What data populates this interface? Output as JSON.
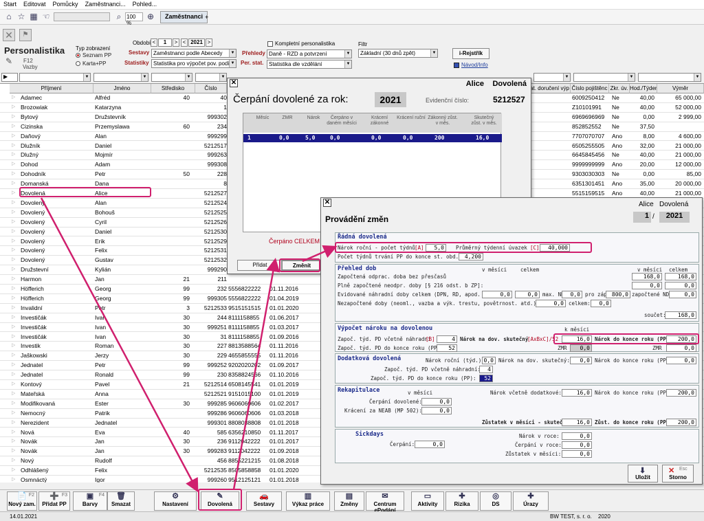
{
  "menu": [
    "Start",
    "Editovat",
    "Pomůcky",
    "Zaměstnanci...",
    "Pohled..."
  ],
  "toolbar": {
    "zoom": "100 %",
    "tab_label": "Zaměstnanci",
    "tab_add": "+"
  },
  "header": {
    "app_title": "Personalistika",
    "f12": "F12",
    "vazby": "Vazby",
    "typ_zobrazeni": "Typ zobrazení",
    "radio_seznam": "Seznam PP",
    "radio_karta": "Karta+PP",
    "obdobi_label": "Období",
    "obdobi_month": "1",
    "obdobi_year": "2021",
    "nav_prev": "<",
    "nav_next": ">",
    "sestavy_label": "Sestavy",
    "sestavy_value": "Zaměstnanci podle Abecedy",
    "statistiky_label": "Statistiky",
    "statistiky_value": "Statistika pro výpočet pov. podílu",
    "kompletni": "Kompletní personalistika",
    "prehledy_label": "Přehledy",
    "prehledy_value": "Daně - RZD a potvrzení",
    "perstat_label": "Per. stat.",
    "perstat_value": "Statistika dle vzdělání",
    "filtr_label": "Filtr",
    "filtr_value": "Základní (30 dnů zpět)",
    "irejstrik": "i-Rejstřík",
    "navod": "Návod/Info"
  },
  "grid": {
    "headers": [
      "Příjmení",
      "Jméno",
      "Středisko",
      "Číslo",
      "at. doručení výp",
      "Číslo pojištěnc",
      "Zkr. úv.",
      "Hod./Týden",
      "Výměr"
    ],
    "rows": [
      {
        "p": "Adamec",
        "j": "Alfréd",
        "s": "40",
        "c": "40",
        "e": "",
        "f": "",
        "pj": "6009250412",
        "z": "Ne",
        "h": "40,00",
        "v": "65 000,00"
      },
      {
        "p": "Brozowiak",
        "j": "Katarzyna",
        "s": "",
        "c": "1",
        "e": "",
        "f": "",
        "pj": "Z10101991",
        "z": "Ne",
        "h": "40,00",
        "v": "52 000,00"
      },
      {
        "p": "Bytový",
        "j": "Družstevník",
        "s": "",
        "c": "999302",
        "e": "",
        "f": "",
        "pj": "6969696969",
        "z": "Ne",
        "h": "0,00",
        "v": "2 999,00"
      },
      {
        "p": "Cizinska",
        "j": "Przemyslawa",
        "s": "60",
        "c": "234",
        "e": "",
        "f": "",
        "pj": "852852552",
        "z": "Ne",
        "h": "37,50",
        "v": ""
      },
      {
        "p": "Daňový",
        "j": "Alan",
        "s": "",
        "c": "999299",
        "e": "",
        "f": "",
        "pj": "7707070707",
        "z": "Ano",
        "h": "8,00",
        "v": "4 600,00"
      },
      {
        "p": "Dlužník",
        "j": "Daniel",
        "s": "",
        "c": "5212517",
        "e": "",
        "f": "",
        "pj": "6505255505",
        "z": "Ano",
        "h": "32,00",
        "v": "21 000,00"
      },
      {
        "p": "Dlužný",
        "j": "Mojmír",
        "s": "",
        "c": "999263",
        "e": "",
        "f": "",
        "pj": "6645845456",
        "z": "Ne",
        "h": "40,00",
        "v": "21 000,00"
      },
      {
        "p": "Dohod",
        "j": "Adam",
        "s": "",
        "c": "999308",
        "e": "",
        "f": "",
        "pj": "9999999999",
        "z": "Ano",
        "h": "20,00",
        "v": "12 000,00"
      },
      {
        "p": "Dohodník",
        "j": "Petr",
        "s": "50",
        "c": "228",
        "e": "",
        "f": "",
        "pj": "9303030303",
        "z": "Ne",
        "h": "0,00",
        "v": "85,00"
      },
      {
        "p": "Domanská",
        "j": "Dana",
        "s": "",
        "c": "8",
        "e": "",
        "f": "",
        "pj": "6351301451",
        "z": "Ano",
        "h": "35,00",
        "v": "20 000,00"
      },
      {
        "p": "Dovolená",
        "j": "Alice",
        "s": "",
        "c": "5212527",
        "e": "",
        "f": "",
        "pj": "5515159515",
        "z": "Ano",
        "h": "40,00",
        "v": "21 000,00"
      },
      {
        "p": "Dovolený",
        "j": "Alan",
        "s": "",
        "c": "5212524",
        "e": "",
        "f": "",
        "pj": "",
        "z": "",
        "h": "",
        "v": ""
      },
      {
        "p": "Dovolený",
        "j": "Bohouš",
        "s": "",
        "c": "5212525",
        "e": "",
        "f": "",
        "pj": "",
        "z": "",
        "h": "",
        "v": ""
      },
      {
        "p": "Dovolený",
        "j": "Cyril",
        "s": "",
        "c": "5212526",
        "e": "",
        "f": "",
        "pj": "",
        "z": "",
        "h": "",
        "v": ""
      },
      {
        "p": "Dovolený",
        "j": "Daniel",
        "s": "",
        "c": "5212530",
        "e": "",
        "f": "",
        "pj": "",
        "z": "",
        "h": "",
        "v": ""
      },
      {
        "p": "Dovolený",
        "j": "Erik",
        "s": "",
        "c": "5212529",
        "e": "",
        "f": "",
        "pj": "",
        "z": "",
        "h": "",
        "v": ""
      },
      {
        "p": "Dovolený",
        "j": "Felix",
        "s": "",
        "c": "5212531",
        "e": "",
        "f": "",
        "pj": "",
        "z": "",
        "h": "",
        "v": ""
      },
      {
        "p": "Dovolený",
        "j": "Gustav",
        "s": "",
        "c": "5212532",
        "e": "",
        "f": "",
        "pj": "",
        "z": "",
        "h": "",
        "v": ""
      },
      {
        "p": "Družstevní",
        "j": "Kylián",
        "s": "",
        "c": "999290",
        "e": "",
        "f": "",
        "pj": "",
        "z": "",
        "h": "",
        "v": ""
      },
      {
        "p": "Harmon",
        "j": "Jan",
        "s": "21",
        "c": "211",
        "e": "",
        "f": "",
        "pj": "",
        "z": "",
        "h": "",
        "v": ""
      },
      {
        "p": "Höfferich",
        "j": "Georg",
        "s": "99",
        "c": "232",
        "e": "5556822222",
        "f": "01.11.2016",
        "pj": "",
        "z": "",
        "h": "",
        "v": ""
      },
      {
        "p": "Höfferich",
        "j": "Georg",
        "s": "99",
        "c": "999305",
        "e": "5556822222",
        "f": "01.04.2019",
        "pj": "",
        "z": "",
        "h": "",
        "v": ""
      },
      {
        "p": "Invalidní",
        "j": "Petr",
        "s": "3",
        "c": "5212533",
        "e": "9515151515",
        "f": "01.01.2020",
        "pj": "",
        "z": "",
        "h": "",
        "v": ""
      },
      {
        "p": "Investičák",
        "j": "Ivan",
        "s": "30",
        "c": "244",
        "e": "8111158855",
        "f": "01.06.2017",
        "pj": "",
        "z": "",
        "h": "",
        "v": ""
      },
      {
        "p": "Investičák",
        "j": "Ivan",
        "s": "30",
        "c": "999251",
        "e": "8111158855",
        "f": "01.03.2017",
        "pj": "",
        "z": "",
        "h": "",
        "v": ""
      },
      {
        "p": "Investičák",
        "j": "Ivan",
        "s": "30",
        "c": "31",
        "e": "8111158855",
        "f": "01.09.2016",
        "pj": "",
        "z": "",
        "h": "",
        "v": ""
      },
      {
        "p": "Investik",
        "j": "Roman",
        "s": "30",
        "c": "227",
        "e": "8813588564",
        "f": "01.11.2016",
        "pj": "",
        "z": "",
        "h": "",
        "v": ""
      },
      {
        "p": "Jaškowski",
        "j": "Jerzy",
        "s": "30",
        "c": "229",
        "e": "4655855555",
        "f": "01.11.2016",
        "pj": "",
        "z": "",
        "h": "",
        "v": ""
      },
      {
        "p": "Jednatel",
        "j": "Petr",
        "s": "99",
        "c": "999252",
        "e": "9202020202",
        "f": "01.09.2017",
        "pj": "",
        "z": "",
        "h": "",
        "v": ""
      },
      {
        "p": "Jednatel",
        "j": "Ronald",
        "s": "99",
        "c": "230",
        "e": "8358824566",
        "f": "01.10.2016",
        "pj": "",
        "z": "",
        "h": "",
        "v": ""
      },
      {
        "p": "Kontový",
        "j": "Pavel",
        "s": "21",
        "c": "5212514",
        "e": "6508145541",
        "f": "01.01.2019",
        "pj": "",
        "z": "",
        "h": "",
        "v": ""
      },
      {
        "p": "Mateřská",
        "j": "Anna",
        "s": "",
        "c": "5212521",
        "e": "9151015100",
        "f": "01.01.2019",
        "pj": "",
        "z": "",
        "h": "",
        "v": ""
      },
      {
        "p": "Modifikovaná",
        "j": "Ester",
        "s": "30",
        "c": "999285",
        "e": "9606060606",
        "f": "01.02.2017",
        "pj": "",
        "z": "",
        "h": "",
        "v": ""
      },
      {
        "p": "Nemocný",
        "j": "Patrik",
        "s": "",
        "c": "999286",
        "e": "9606060606",
        "f": "01.03.2018",
        "pj": "",
        "z": "",
        "h": "",
        "v": ""
      },
      {
        "p": "Nerezident",
        "j": "Jednatel",
        "s": "",
        "c": "999301",
        "e": "8808088808",
        "f": "01.01.2018",
        "pj": "",
        "z": "",
        "h": "",
        "v": ""
      },
      {
        "p": "Nová",
        "j": "Eva",
        "s": "40",
        "c": "585",
        "e": "6356210850",
        "f": "01.11.2017",
        "pj": "",
        "z": "",
        "h": "",
        "v": ""
      },
      {
        "p": "Novák",
        "j": "Jan",
        "s": "30",
        "c": "236",
        "e": "9112042222",
        "f": "01.01.2017",
        "pj": "",
        "z": "",
        "h": "",
        "v": ""
      },
      {
        "p": "Novák",
        "j": "Jan",
        "s": "30",
        "c": "999283",
        "e": "9112042222",
        "f": "01.09.2018",
        "pj": "",
        "z": "",
        "h": "",
        "v": ""
      },
      {
        "p": "Nový",
        "j": "Rudolf",
        "s": "",
        "c": "456",
        "e": "8855221215",
        "f": "01.08.2018",
        "pj": "",
        "z": "",
        "h": "",
        "v": ""
      },
      {
        "p": "Odhlášený",
        "j": "Felix",
        "s": "",
        "c": "5212535",
        "e": "8505858858",
        "f": "01.01.2020",
        "pj": "",
        "z": "",
        "h": "",
        "v": ""
      },
      {
        "p": "Osmnáctý",
        "j": "Igor",
        "s": "",
        "c": "999260",
        "e": "9512125121",
        "f": "01.01.2018",
        "pj": "",
        "z": "",
        "h": "",
        "v": ""
      },
      {
        "p": "Osmnáctý",
        "j": "Igor",
        "s": "",
        "c": "999257",
        "e": "9512125121",
        "f": "04.01.2018",
        "pj": "",
        "z": "",
        "h": "",
        "v": ""
      }
    ]
  },
  "cerpani": {
    "name1": "Alice",
    "name2": "Dovolená",
    "title": "Čerpání dovolené za rok:",
    "year": "2021",
    "ev_label": "Evidenční číslo:",
    "ev_value": "5212527",
    "cols": [
      "Měsíc",
      "ZMR",
      "Nárok",
      "Čerpáno v daném měsíci",
      "Krácení zákonné",
      "Krácení ruční",
      "Zákonný zůst. v měs.",
      "Skutečný zůst. v měs."
    ],
    "row": [
      "1",
      "0,0",
      "5,0",
      "0,0",
      "0,0",
      "0,0",
      "200",
      "16,0"
    ],
    "footer": "Čerpáno CELKEM",
    "btn_pridat": "Přidat",
    "btn_zmenit": "Změnit"
  },
  "zmeny": {
    "name1": "Alice",
    "name2": "Dovolená",
    "title": "Provádění změn",
    "month": "1",
    "year": "2021",
    "sec1": "Řádná dovolená",
    "narok_rocni_label": "Nárok roční - počet týdnů",
    "narok_rocni_tag": "[A]",
    "narok_rocni_value": "5,0",
    "prumerny_label": "Průměrný týdenní úvazek",
    "prumerny_tag": "[C]",
    "prumerny_value": "40,000",
    "pocet_tydnu_label": "Počet týdnů trvání PP do konce st. obd.:",
    "pocet_tydnu_value": "4,200",
    "sec2": "Přehled dob",
    "v_mesici": "v měsíci",
    "celkem": "celkem",
    "zapoc_label": "Započtená odprac. doba bez přesčasů",
    "zapoc_m": "168,0",
    "zapoc_c": "168,0",
    "plne_label": "Plně započtené neodpr. doby [§ 216 odst. b ZP]:",
    "plne_m": "0,0",
    "plne_c": "0,0",
    "evid_label": "Evidované náhradní doby celkem (DPN, RD, apod.",
    "evid_v": "0,0",
    "maxnd_label": "max. ND",
    "maxnd_v": "0,0",
    "prozap_label": "pro záp.",
    "prozap_v": "800,0",
    "zapnd_label": "započtené ND",
    "zapnd_v": "0,0",
    "nezap_label": "Nezapočtené doby (neoml., vazba a výk. trestu, povětrnost. atd.) v měs.:",
    "nezap_m": "0,0",
    "nezap_c_label": "celkem:",
    "nezap_c": "0,0",
    "soucet_label": "součet:",
    "soucet_v": "168,0",
    "sec3": "Výpočet nároku na dovolenou",
    "k_mesici": "k měsíci",
    "zapoc_tyd_label": "Započ. týd. PD včetně náhradní",
    "zapoc_tyd_tag": "[B]",
    "zapoc_tyd_v": "4",
    "narok_skut_label": "Nárok na dov. skutečný",
    "narok_skut_tag": "[AxBxC]/52",
    "narok_skut_v": "16,0",
    "narok_konec_label": "Nárok do konce roku (PP):",
    "narok_konec_v": "200,0",
    "zapoc_pp_label": "Započ. týd. PD do konce roku (PP):",
    "zapoc_pp_v": "52",
    "zmr_label": "ZMR",
    "zmr_v": "0,0",
    "zmr2_label": "ZMR",
    "zmr2_v": "0,0",
    "sec4": "Dodatková dovolená",
    "dod_narok_label": "Nárok roční (týd.):",
    "dod_narok_v": "0,0",
    "dod_skut_label": "Nárok na dov. skutečný:",
    "dod_skut_v": "0,0",
    "dod_konec_label": "Nárok do konce roku (PP):",
    "dod_konec_v": "0,0",
    "dod_zapoc_label": "Započ. týd. PD včetně náhradní:",
    "dod_zapoc_v": "4",
    "dod_zapoc_pp_label": "Započ. týd. PD do konce roku (PP):",
    "dod_zapoc_pp_v": "52",
    "sec5": "Rekapitulace",
    "rek_vmesici": "v měsíci",
    "cerp_dov_label": "Čerpání dovolené:",
    "cerp_dov_v": "0,0",
    "kraceni_label": "Krácení za NEAB (MP 502):",
    "kraceni_v": "0,0",
    "narok_vcetne_label": "Nárok včetně dodatkové:",
    "narok_vcetne_v": "16,0",
    "narok_konec2_label": "Nárok do konce roku (PP):",
    "narok_konec2_v": "200,0",
    "zustatek_label": "Zůstatek v měsíci - skutečný :",
    "zustatek_v": "16,0",
    "zust_konec_label": "Zůst. do konce roku (PP) :",
    "zust_konec_v": "200,0",
    "sec6": "Sickdays",
    "sick_cerp_label": "Čerpání:",
    "sick_cerp_v": "0,0",
    "sick_narok_label": "Nárok v roce:",
    "sick_narok_v": "0,0",
    "sick_cerproce_label": "Čerpání v roce:",
    "sick_cerproce_v": "0,0",
    "sick_zust_label": "Zůstatek v měsíci:",
    "sick_zust_v": "0,0",
    "btn_ulozit": "Uložit",
    "btn_storno": "Storno",
    "esc": "Esc"
  },
  "bottom": {
    "buttons": [
      {
        "label": "Nový zam.",
        "key": "F2"
      },
      {
        "label": "Přidat PP",
        "key": "F3"
      },
      {
        "label": "Barvy",
        "key": "F4"
      },
      {
        "label": "Smazat",
        "key": ""
      },
      {
        "label": "Nastavení",
        "key": ""
      },
      {
        "label": "Dovolená",
        "key": ""
      },
      {
        "label": "Sestavy",
        "key": ""
      },
      {
        "label": "Výkaz práce",
        "key": ""
      },
      {
        "label": "Změny",
        "key": ""
      },
      {
        "label": "Centrum ePodání",
        "key": ""
      },
      {
        "label": "Aktivity",
        "key": ""
      },
      {
        "label": "Rizika",
        "key": ""
      },
      {
        "label": "DS",
        "key": ""
      },
      {
        "label": "Úrazy",
        "key": ""
      }
    ]
  },
  "status": {
    "date": "14.01.2021",
    "company": "BW TEST, s. r. o.",
    "year": "2020"
  },
  "colors": {
    "highlight": "#d0206e",
    "selected_row": "#1a1a8a",
    "accent_red": "#9c1a1a"
  }
}
